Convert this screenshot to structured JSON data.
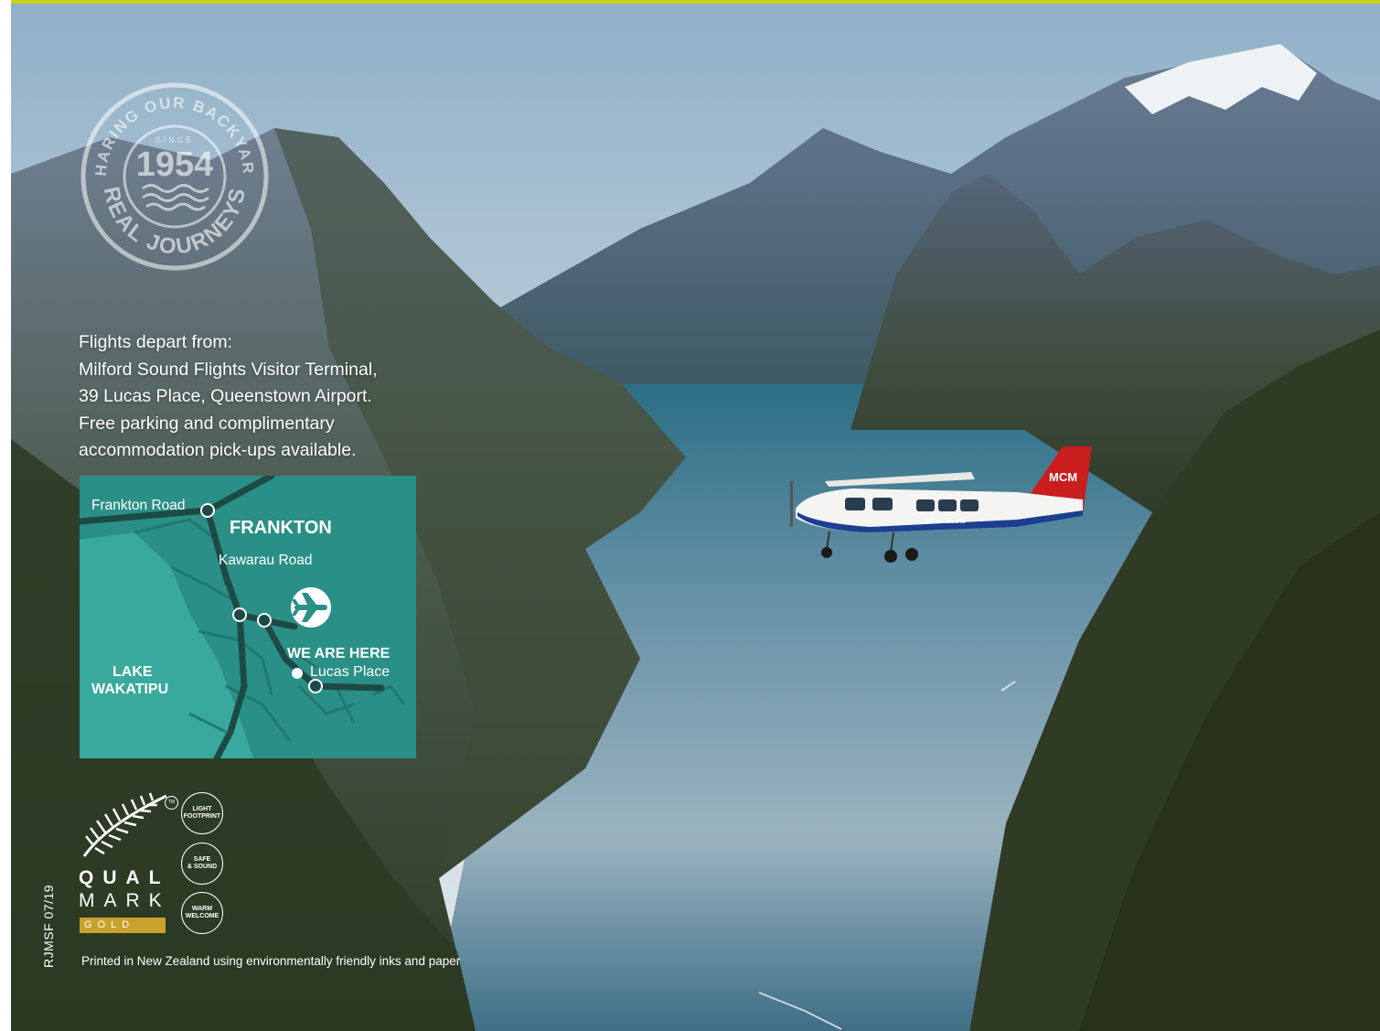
{
  "stamp": {
    "top_arc": "SHARING OUR BACKYARD",
    "since_label": "SINCE",
    "year": "1954",
    "bottom_arc": "REAL JOURNEYS"
  },
  "departure": {
    "lines": [
      "Flights depart from:",
      "Milford Sound Flights Visitor Terminal,",
      "39 Lucas Place, Queenstown Airport.",
      "Free parking and complimentary",
      "accommodation pick-ups available."
    ]
  },
  "map": {
    "frankton_road": "Frankton Road",
    "suburb": "FRANKTON",
    "kawarau_road": "Kawarau Road",
    "we_are_here": "WE ARE HERE",
    "location": "Lucas Place",
    "lake_line1": "LAKE",
    "lake_line2": "WAKATIPU",
    "airport_icon": "airplane-icon"
  },
  "plane": {
    "tail_code": "MCM",
    "fuselage_text": "Milford Sound"
  },
  "qualmark": {
    "line1": "QUAL",
    "line2": "MARK",
    "tier": "GOLD",
    "tm": "TM",
    "badges": [
      {
        "line1": "LIGHT",
        "line2": "FOOTPRINT"
      },
      {
        "line1": "SAFE",
        "line2": "& SOUND"
      },
      {
        "line1": "WARM",
        "line2": "WELCOME"
      }
    ]
  },
  "footer": {
    "print_code": "RJMSF 07/19",
    "printed_note": "Printed in New Zealand using environmentally friendly inks and paper"
  },
  "colors": {
    "accent": "#c9d21c",
    "map_bg": "#2a8f86",
    "gold": "#c8a12c",
    "plane_red": "#c81e1e",
    "plane_blue": "#1d3f8f"
  }
}
